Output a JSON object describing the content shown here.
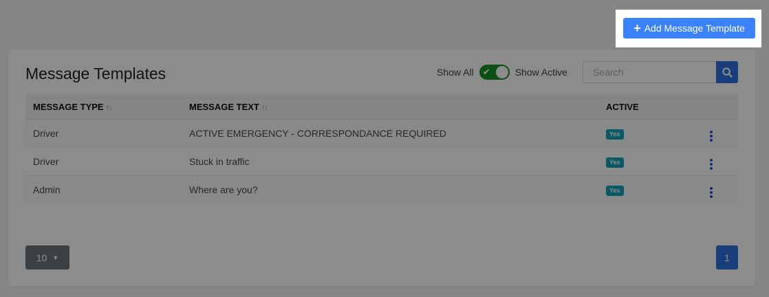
{
  "header": {
    "add_button_label": "Add Message Template",
    "add_button_icon": "plus-icon"
  },
  "card": {
    "title": "Message Templates",
    "toggle": {
      "left_label": "Show All",
      "right_label": "Show Active",
      "state": "Show Active",
      "check_glyph": "✔"
    },
    "search": {
      "placeholder": "Search",
      "value": "",
      "icon": "search-icon"
    }
  },
  "table": {
    "columns": [
      {
        "label": "MESSAGE TYPE",
        "sortable": true
      },
      {
        "label": "MESSAGE TEXT",
        "sortable": true
      },
      {
        "label": "ACTIVE",
        "sortable": false
      },
      {
        "label": "",
        "sortable": false
      }
    ],
    "sort_glyph": "↑↓",
    "rows": [
      {
        "type": "Driver",
        "text": "ACTIVE EMERGENCY - CORRESPONDANCE REQUIRED",
        "active": "Yes"
      },
      {
        "type": "Driver",
        "text": "Stuck in traffic",
        "active": "Yes"
      },
      {
        "type": "Admin",
        "text": "Where are you?",
        "active": "Yes"
      }
    ]
  },
  "footer": {
    "page_size": "10",
    "current_page": "1"
  },
  "colors": {
    "primary": "#3b82f6",
    "toggle_on": "#1a8f2a",
    "badge": "#17a2b8",
    "secondary_button": "#6c757d"
  }
}
